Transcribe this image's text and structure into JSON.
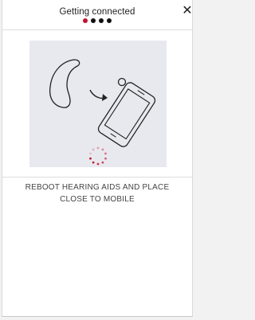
{
  "header": {
    "title": "Getting connected",
    "close_symbol": "✕",
    "steps": [
      {
        "state": "active"
      },
      {
        "state": "inactive"
      },
      {
        "state": "inactive"
      },
      {
        "state": "inactive"
      }
    ]
  },
  "illustration": {
    "icons": [
      "hearing-aid-icon",
      "arrow-icon",
      "mobile-phone-icon",
      "loading-spinner-icon"
    ]
  },
  "instruction": {
    "line1": "REBOOT HEARING AIDS AND PLACE",
    "line2": "CLOSE TO MOBILE"
  },
  "colors": {
    "accent": "#c4122f",
    "illustration_bg": "#e8e9ef"
  }
}
